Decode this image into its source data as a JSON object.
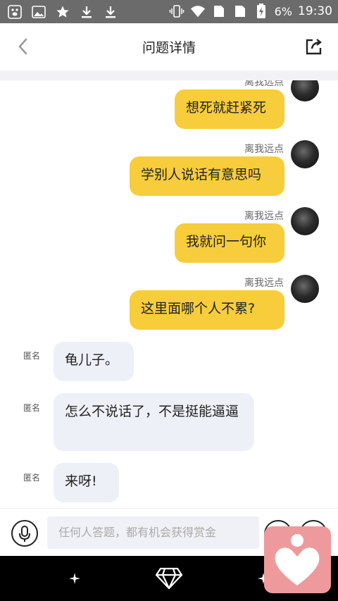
{
  "status_bar": {
    "battery": "6%",
    "time": "19:30"
  },
  "header": {
    "title": "问题详情"
  },
  "messages": [
    {
      "side": "right",
      "meta": "离我远点",
      "text": "想死就赶紧死"
    },
    {
      "side": "right",
      "meta": "离我远点",
      "text": "学别人说话有意思吗"
    },
    {
      "side": "right",
      "meta": "离我远点",
      "text": "我就问一句你"
    },
    {
      "side": "right",
      "meta": "离我远点",
      "text": "这里面哪个人不累?"
    },
    {
      "side": "left",
      "meta": "匿名",
      "text": "龟儿子。"
    },
    {
      "side": "left",
      "meta": "匿名",
      "text": "怎么不说话了，不是挺能逼逼"
    },
    {
      "side": "left",
      "meta": "匿名",
      "text": "来呀!"
    }
  ],
  "input": {
    "placeholder": "任何人答题，都有机会获得赏金"
  },
  "colors": {
    "my_bubble": "#f7cd3c",
    "their_bubble": "#eef0f7",
    "float_app": "#ee9a9c"
  },
  "icons": [
    "back-arrow-icon",
    "share-icon",
    "mic-icon",
    "diamond-icon",
    "heart-app-icon"
  ]
}
